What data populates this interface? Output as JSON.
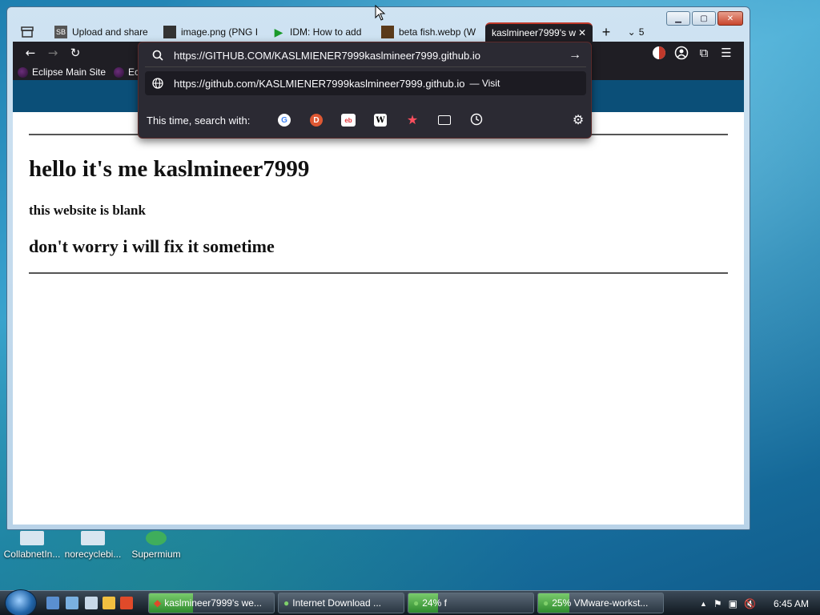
{
  "browser": {
    "tabs": [
      {
        "label": "",
        "icon": "tab-overview-icon"
      },
      {
        "label": "Upload and share",
        "icon": "sb-icon"
      },
      {
        "label": "image.png (PNG I",
        "icon": "image-icon"
      },
      {
        "label": "IDM: How to add",
        "icon": "idm-play-icon"
      },
      {
        "label": "beta fish.webp (W",
        "icon": "image-icon"
      },
      {
        "label": "kaslmineer7999's w",
        "icon": "",
        "active": true
      }
    ],
    "tab_count": "5",
    "url_input": "https://GITHUB.COM/KASLMIENER7999kaslmineer7999.github.io",
    "suggestion_url": "https://github.com/KASLMIENER7999kaslmineer7999.github.io",
    "suggestion_action": "— Visit",
    "search_with_label": "This time, search with:",
    "bookmarks": [
      "Eclipse Main Site",
      "Ec"
    ],
    "accent": "#c0392b"
  },
  "page": {
    "heading": "hello it's me kaslmineer7999",
    "subheading": "this website is blank",
    "note": "don't worry i will fix it sometime"
  },
  "desktop": {
    "icons": [
      "CollabnetIn...",
      "norecyclebi...",
      "Supermium"
    ]
  },
  "taskbar": {
    "tasks": [
      {
        "label": "kaslmineer7999's we...",
        "progress": 0.35
      },
      {
        "label": "Internet Download ...",
        "progress": 0
      },
      {
        "label": "24% f",
        "progress": 0.24
      },
      {
        "label": "25% VMware-workst...",
        "progress": 0.25
      }
    ],
    "clock": "6:45 AM"
  }
}
